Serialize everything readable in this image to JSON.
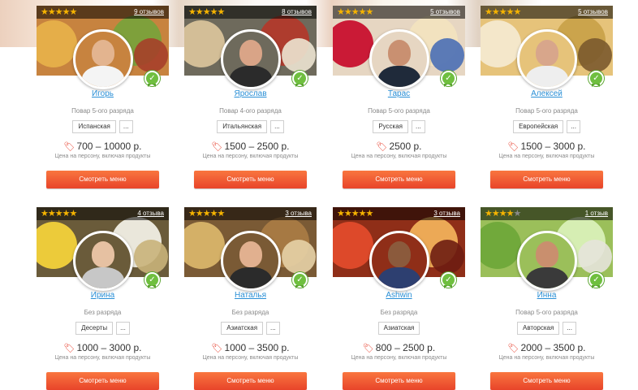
{
  "cards": [
    {
      "reviews": "9 отзывов",
      "stars": 5,
      "name": "Игорь",
      "rank": "Повар 5-ого разряда",
      "tag": "Испанская",
      "more": "...",
      "price": "700 – 10000 р.",
      "note": "Цена на персону, включая продукты",
      "button": "Смотреть меню",
      "colors": {
        "bg": "#c7833f",
        "food1": "#e7b04a",
        "food2": "#7aa13b",
        "food3": "#a63f2a",
        "face": "#e3b48f",
        "body": "#f4f4f4"
      }
    },
    {
      "reviews": "8 отзывов",
      "stars": 5,
      "name": "Ярослав",
      "rank": "Повар 4-ого разряда",
      "tag": "Итальянская",
      "more": "...",
      "price": "1500 – 2500 р.",
      "note": "Цена на персону, включая продукты",
      "button": "Смотреть меню",
      "colors": {
        "bg": "#6e6a5c",
        "food1": "#d8c39a",
        "food2": "#b13a2b",
        "food3": "#ece4d2",
        "face": "#d9a487",
        "body": "#2b2b2b"
      }
    },
    {
      "reviews": "5 отзывов",
      "stars": 5,
      "name": "Тарас",
      "rank": "Повар 5-ого разряда",
      "tag": "Русская",
      "more": "...",
      "price": "2500 р.",
      "note": "Цена на персону, включая продукты",
      "button": "Смотреть меню",
      "colors": {
        "bg": "#e6d6c2",
        "food1": "#c8102e",
        "food2": "#f2e3bf",
        "food3": "#4a6fb5",
        "face": "#c99071",
        "body": "#1f2a3a"
      }
    },
    {
      "reviews": "5 отзывов",
      "stars": 5,
      "name": "Алексей",
      "rank": "Повар 5-ого разряда",
      "tag": "Европейская",
      "more": "...",
      "price": "1500 – 3000 р.",
      "note": "Цена на персону, включая продукты",
      "button": "Смотреть меню",
      "colors": {
        "bg": "#e6c37a",
        "food1": "#f4e9cf",
        "food2": "#c9a24a",
        "food3": "#7b5a2e",
        "face": "#d8a68b",
        "body": "#eeeeee"
      }
    },
    {
      "reviews": "4 отзыва",
      "stars": 5,
      "name": "Ирина",
      "rank": "Без разряда",
      "tag": "Десерты",
      "more": "...",
      "price": "1000 – 3000 р.",
      "note": "Цена на персону, включая продукты",
      "button": "Смотреть меню",
      "colors": {
        "bg": "#6a5b3a",
        "food1": "#f3d23a",
        "food2": "#f1efe4",
        "food3": "#c9b27a",
        "face": "#e6c1a2",
        "body": "#c7c7c7"
      }
    },
    {
      "reviews": "3 отзыва",
      "stars": 5,
      "name": "Наталья",
      "rank": "Без разряда",
      "tag": "Азиатская",
      "more": "...",
      "price": "1000 – 3500 р.",
      "note": "Цена на персону, включая продукты",
      "button": "Смотреть меню",
      "colors": {
        "bg": "#7a5a35",
        "food1": "#d9b56a",
        "food2": "#a97b44",
        "food3": "#e7d2a7",
        "face": "#e1b08f",
        "body": "#2b2b2b"
      }
    },
    {
      "reviews": "3 отзыва",
      "stars": 5,
      "name": "Ashwin",
      "rank": "Без разряда",
      "tag": "Азиатская",
      "more": "",
      "price": "800 – 2500 р.",
      "note": "Цена на персону, включая продукты",
      "button": "Смотреть меню",
      "colors": {
        "bg": "#8f2e18",
        "food1": "#e24b2b",
        "food2": "#f1b05a",
        "food3": "#6e1d12",
        "face": "#8b5a3c",
        "body": "#2d3f70"
      }
    },
    {
      "reviews": "1 отзыв",
      "stars": 4,
      "name": "Инна",
      "rank": "Повар 5-ого разряда",
      "tag": "Авторская",
      "more": "...",
      "price": "2000 – 3500 р.",
      "note": "Цена на персону, включая продукты",
      "button": "Смотреть меню",
      "colors": {
        "bg": "#9bbf5a",
        "food1": "#6fa83a",
        "food2": "#d9f0b8",
        "food3": "#e6e3da",
        "face": "#c98f6e",
        "body": "#3a3a3a"
      }
    }
  ],
  "icons": {
    "star": "star-icon",
    "tag": "price-tag-icon",
    "badge": "verified-badge-icon"
  }
}
